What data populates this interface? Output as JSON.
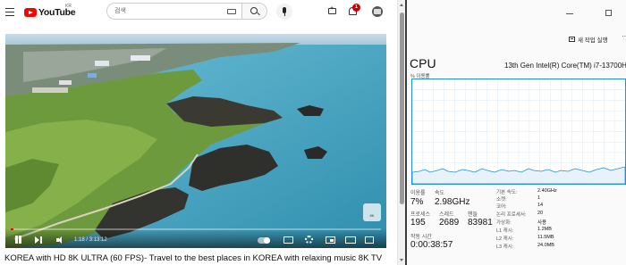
{
  "youtube": {
    "logo_text": "YouTube",
    "region_code": "KR",
    "search_placeholder": "검색",
    "notification_count": "1",
    "player": {
      "progress_fraction": 0.0,
      "current_time": "1:18",
      "duration": "3:13:12",
      "watermark": "8K"
    },
    "video_title": "KOREA with HD 8K ULTRA (60 FPS)- Travel to the best places in KOREA with relaxing music 8K TV"
  },
  "task_manager": {
    "new_task_label": "새 작업 실행",
    "more_label": "···",
    "title": "CPU",
    "cpu_model": "13th Gen Intel(R) Core(TM) i7-13700H",
    "usage_axis_label": "% 이용률",
    "graph_color": "#1f8fd6",
    "stats": {
      "utilization_label": "이용률",
      "utilization_value": "7%",
      "speed_label": "속도",
      "speed_value": "2.98GHz",
      "processes_label": "프로세스",
      "processes_value": "195",
      "threads_label": "스레드",
      "threads_value": "2689",
      "handles_label": "핸들",
      "handles_value": "83981",
      "uptime_label": "작동 시간",
      "uptime_value": "0:00:38:57"
    },
    "specs": [
      {
        "label": "기본 속도:",
        "value": "2.40GHz"
      },
      {
        "label": "소켓:",
        "value": "1"
      },
      {
        "label": "코어:",
        "value": "14"
      },
      {
        "label": "논리 프로세서:",
        "value": "20"
      },
      {
        "label": "가상화:",
        "value": "사용"
      },
      {
        "label": "L1 캐시:",
        "value": "1.2MB"
      },
      {
        "label": "L2 캐시:",
        "value": "11.5MB"
      },
      {
        "label": "L3 캐시:",
        "value": "24.0MB"
      }
    ]
  }
}
